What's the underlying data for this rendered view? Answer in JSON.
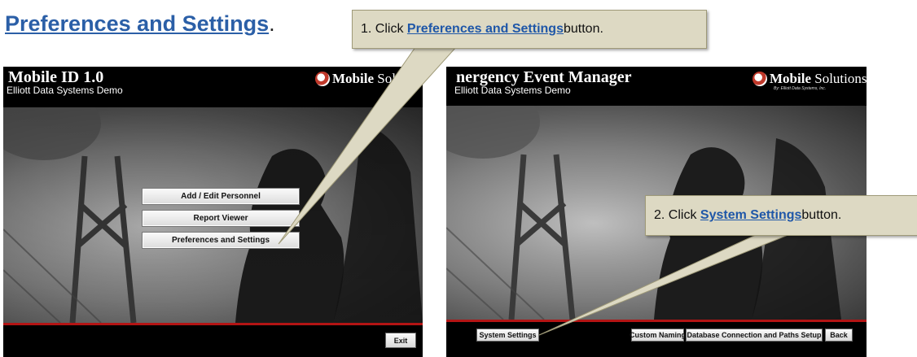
{
  "heading": {
    "link_text": "Preferences and Settings",
    "suffix": "."
  },
  "left_screen": {
    "title": "Mobile ID 1.0",
    "subtitle": "Elliott Data Systems Demo",
    "logo_bold": "Mobile",
    "logo_rest": " Soluti",
    "menu": {
      "add_edit": "Add / Edit  Personnel",
      "report": "Report Viewer",
      "prefs": "Preferences and Settings"
    },
    "exit_label": "Exit"
  },
  "right_screen": {
    "title": "nergency Event Manager",
    "subtitle": "Elliott Data Systems Demo",
    "logo_bold": "Mobile",
    "logo_rest": " Solutions",
    "logo_sub": "By: Elliott Data Systems, Inc.",
    "buttons": {
      "system_settings": "System Settings",
      "custom_naming": "Custom Naming",
      "db_paths": "Database Connection and Paths Setup",
      "back": "Back"
    }
  },
  "callouts": {
    "step1": {
      "prefix": "1. Click ",
      "keyword": "Preferences and Settings",
      "suffix": " button."
    },
    "step2": {
      "prefix": "2. Click ",
      "keyword": "System Settings",
      "suffix": " button."
    }
  },
  "colors": {
    "heading": "#2b5fa7",
    "callout_bg": "#ddd9c3",
    "accent_red": "#b31414"
  }
}
